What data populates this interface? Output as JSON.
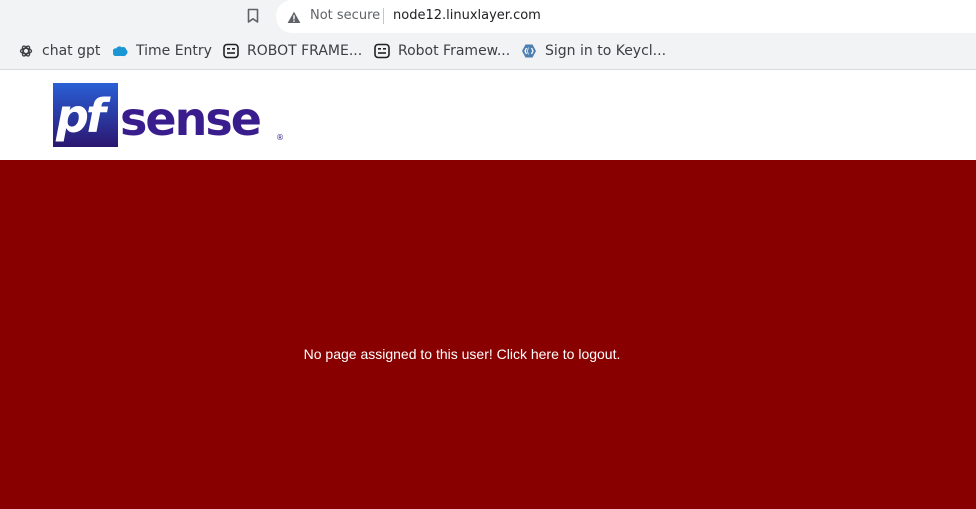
{
  "browser": {
    "security_label": "Not secure",
    "url": "node12.linuxlayer.com"
  },
  "bookmarks": [
    {
      "label": "chat gpt",
      "icon": "openai-icon"
    },
    {
      "label": "Time Entry",
      "icon": "salesforce-cloud-icon"
    },
    {
      "label": "ROBOT FRAME...",
      "icon": "robot-icon"
    },
    {
      "label": "Robot Framew...",
      "icon": "robot-icon"
    },
    {
      "label": "Sign in to Keycl...",
      "icon": "keycloak-icon"
    }
  ],
  "logo": {
    "text_pf": "pf",
    "text_sense": "sense",
    "mark": "®"
  },
  "main": {
    "message": "No page assigned to this user! Click here to logout."
  },
  "colors": {
    "background_red": "#880000",
    "logo_purple": "#3a1d8c",
    "logo_block": "#2b1670"
  }
}
